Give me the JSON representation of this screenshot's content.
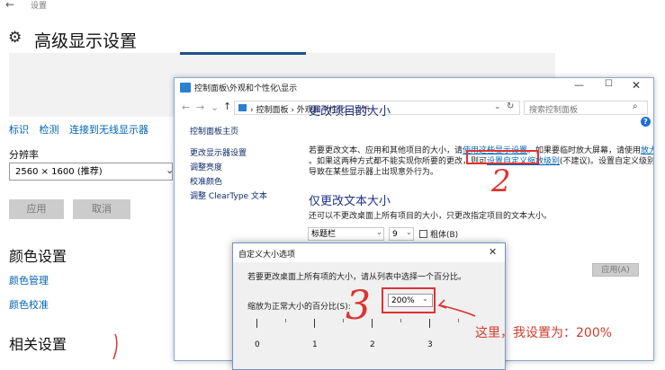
{
  "settings": {
    "back_glyph": "←",
    "breadcrumb": "设置",
    "gear_glyph": "⚙",
    "title": "高级显示设置",
    "links": [
      "标识",
      "检测",
      "连接到无线显示器"
    ],
    "resolution_label": "分辨率",
    "resolution_value": "2560 × 1600 (推荐)",
    "apply_label": "应用",
    "cancel_label": "取消",
    "color_settings_title": "颜色设置",
    "color_management": "颜色管理",
    "color_calibration": "颜色校准",
    "related_settings_title": "相关设置"
  },
  "control_panel": {
    "window_title": "控制面板\\外观和个性化\\显示",
    "address_path": "›  控制面板  ›  外观和个性化  ›  显示",
    "search_placeholder": "搜索控制面板",
    "sidebar": [
      "控制面板主页",
      "更改显示器设置",
      "调整亮度",
      "校准颜色",
      "调整 ClearType 文本"
    ],
    "heading_size": "更改项目的大小",
    "para1_a_pre": "若要更改文本、应用和其他项目的大小，请",
    "para1_a_link": "使用这些显示设置",
    "para1_a_mid": "。如果要临时放大屏幕，请使用",
    "para1_a_link2": "放大镜",
    "para1_b_pre": "。如果这两种方式都不能实现你所要的更改，则可",
    "para1_b_link": "设置自定义缩放级别",
    "para1_b_post": "(不建议)。设置自定义级别可能会",
    "para1_c": "导致在某些显示器上出现意外行为。",
    "heading_text": "仅更改文本大小",
    "para2": "还可以不更改桌面上所有项目的大小，只更改指定项目的文本大小。",
    "item_select": "标题栏",
    "size_select": "9",
    "bold_label": "粗体(B)",
    "apply_label": "应用(A)"
  },
  "dialog": {
    "title": "自定义大小选项",
    "description": "若要更改桌面上所有项的大小，请从列表中选择一个百分比。",
    "scale_label": "缩放为正常大小的百分比(S):",
    "scale_value": "200%",
    "ruler_labels": [
      "0",
      "1",
      "2",
      "3"
    ]
  },
  "annotations": {
    "number_2": "2",
    "number_3": "3",
    "note": "这里，我设置为：200%",
    "color": "#d33"
  }
}
